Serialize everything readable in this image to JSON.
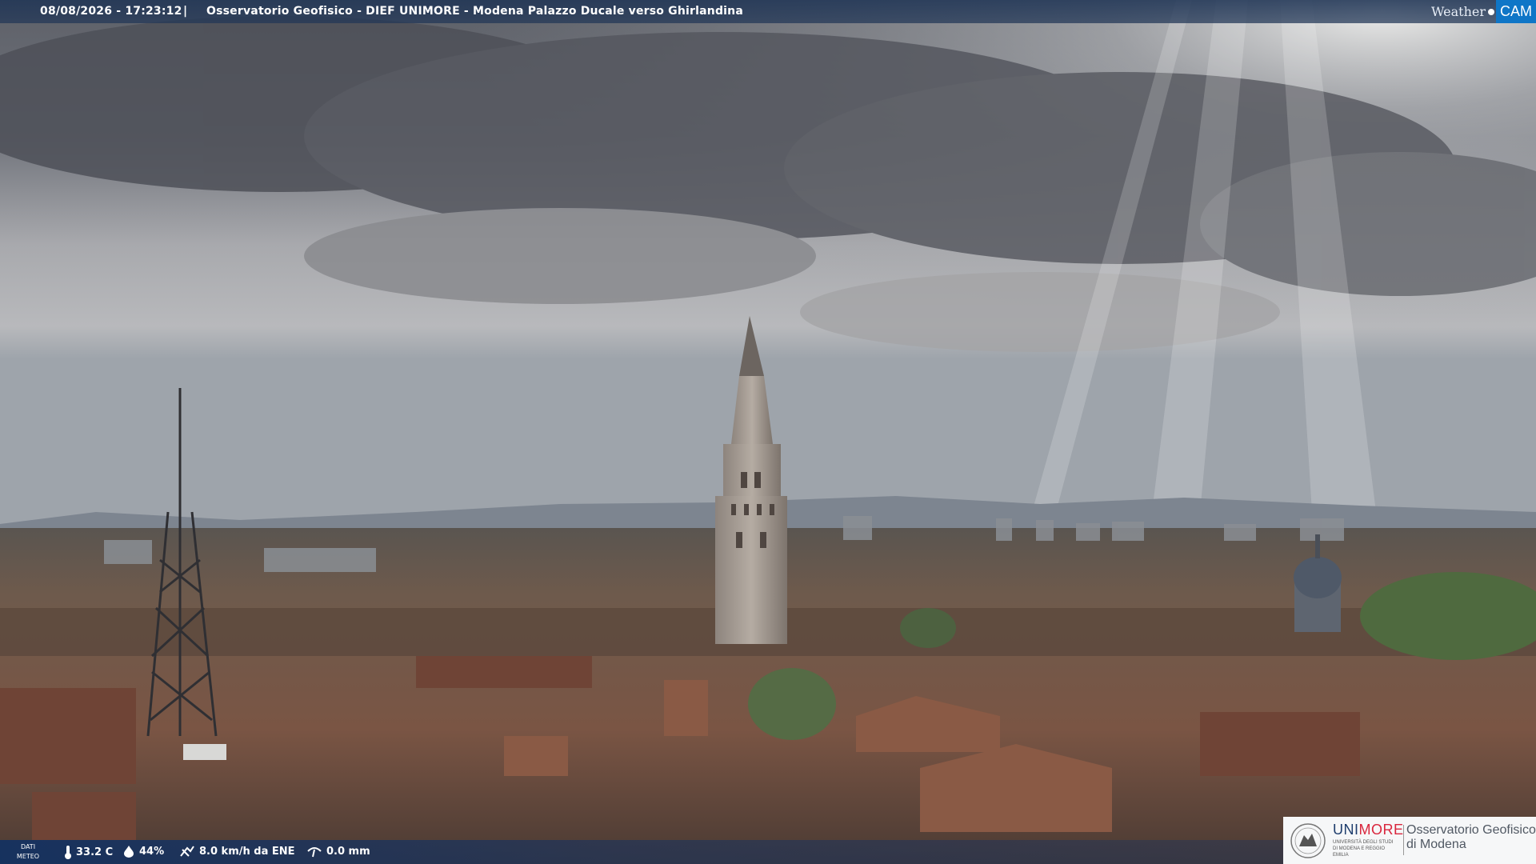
{
  "header": {
    "datetime": "08/08/2026 - 17:23:12",
    "separator": "|",
    "location": "Osservatorio Geofisico - DIEF UNIMORE - Modena Palazzo Ducale verso Ghirlandina"
  },
  "brand": {
    "weather": "Weather",
    "cam": "CAM"
  },
  "weather_bar": {
    "label_line1": "DATI",
    "label_line2": "METEO",
    "temperature": "33.2 C",
    "humidity": "44%",
    "wind": "8.0 km/h da ENE",
    "rain": "0.0 mm",
    "icons": [
      "thermometer-icon",
      "humidity-drop-icon",
      "wind-icon",
      "rain-icon"
    ]
  },
  "logo": {
    "uni_part1": "UNI",
    "uni_part2": "MORE",
    "uni_sub": "UNIVERSITÀ DEGLI STUDI DI MODENA E REGGIO EMILIA",
    "observatory_line1": "Osservatorio Geofisico",
    "observatory_line2": "di Modena"
  },
  "colors": {
    "bar_blue": "#213656",
    "brand_blue": "#0f76c7",
    "unimore_red": "#d9263d",
    "unimore_blue": "#1e3d6d"
  }
}
